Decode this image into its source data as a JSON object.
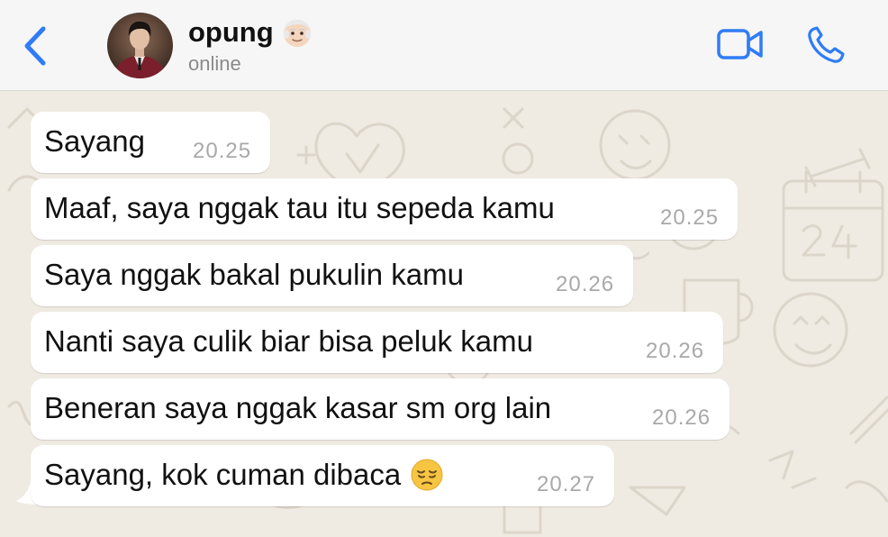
{
  "header": {
    "contact_name": "opung",
    "status": "online",
    "icons": {
      "back": "chevron-left-icon",
      "avatar_emoji": "old-man-emoji",
      "video": "video-camera-icon",
      "call": "phone-icon"
    },
    "accent_color": "#2f7cf6"
  },
  "messages": [
    {
      "text": "Sayang",
      "time": "20.25"
    },
    {
      "text": "Maaf, saya nggak tau itu sepeda kamu",
      "time": "20.25"
    },
    {
      "text": "Saya nggak bakal pukulin kamu",
      "time": "20.26"
    },
    {
      "text": "Nanti saya culik biar bisa peluk kamu",
      "time": "20.26"
    },
    {
      "text": "Beneran saya nggak kasar sm org lain",
      "time": "20.26"
    },
    {
      "text": "Sayang, kok cuman dibaca",
      "time": "20.27",
      "emoji": "pensive-face-emoji"
    }
  ]
}
